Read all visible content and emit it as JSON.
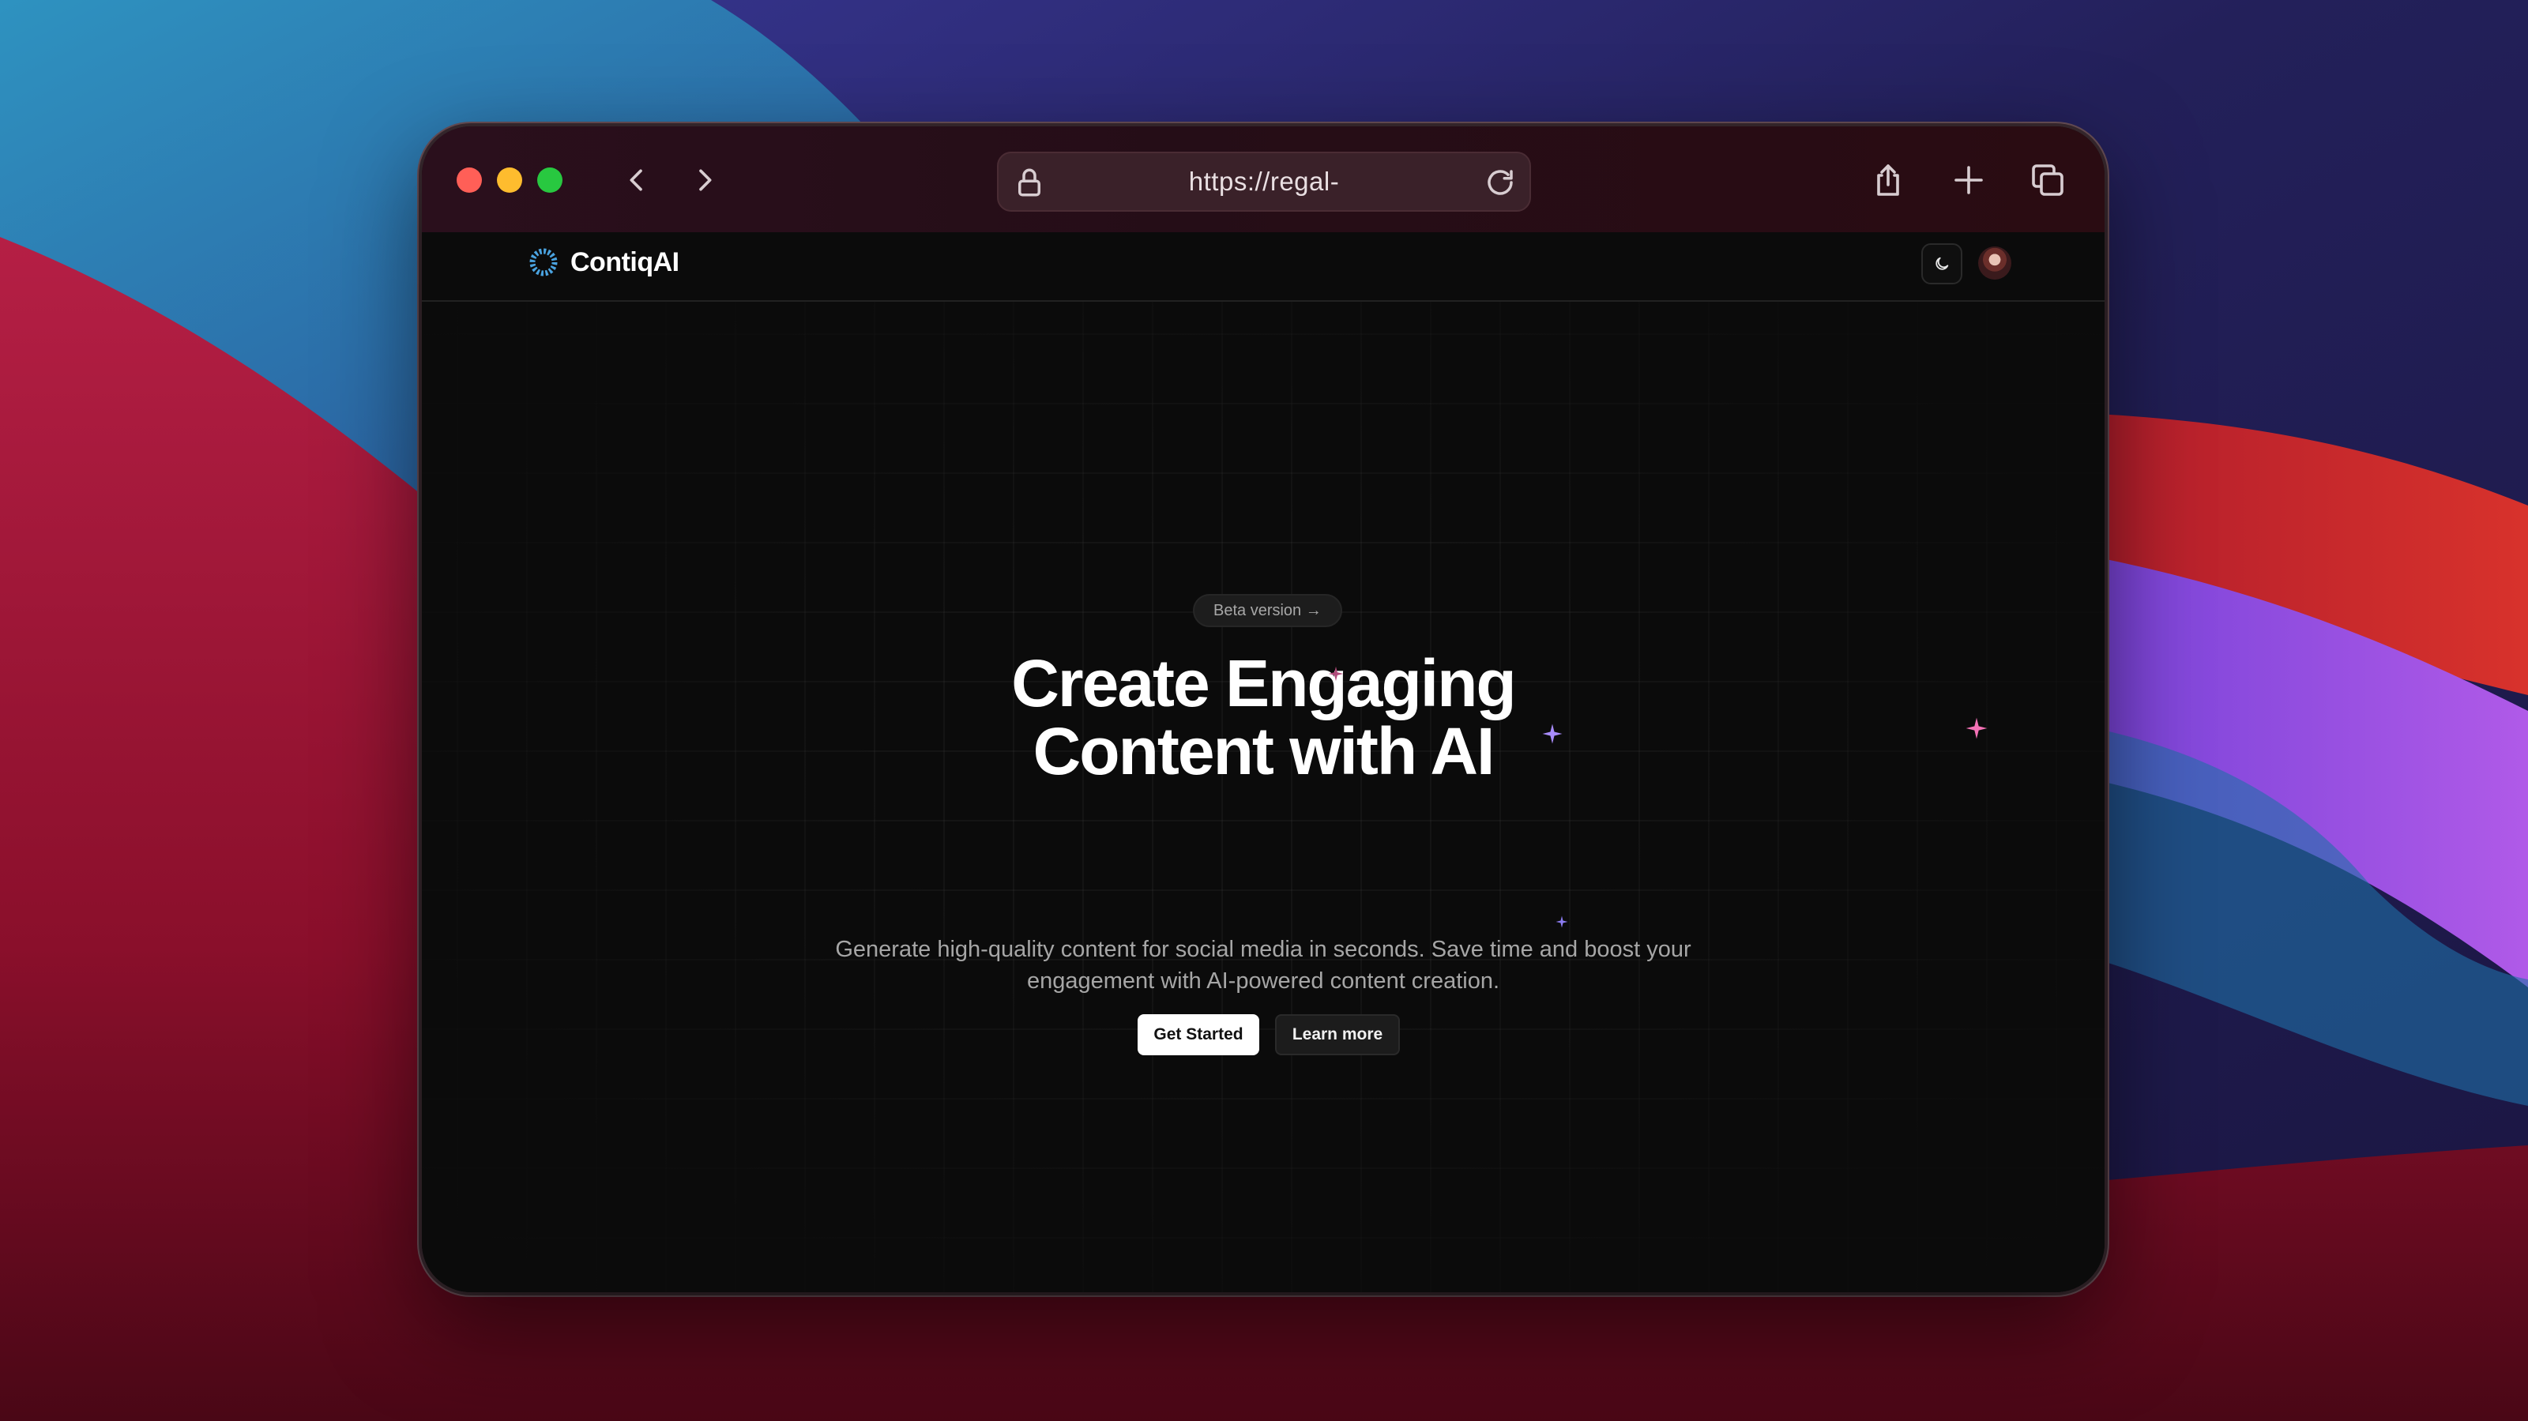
{
  "browser": {
    "url": "https://regal-"
  },
  "site": {
    "brand": "ContiqAI"
  },
  "hero": {
    "badge": "Beta version →",
    "headline_line1": "Create Engaging",
    "headline_line2": "Content with AI",
    "subtext_line1": "Generate high-quality content for social media in seconds. Save time and boost your",
    "subtext_line2": "engagement with AI-powered content creation.",
    "primary_button": "Get Started",
    "secondary_button": "Learn more"
  },
  "icons": {
    "lock": "lock-icon",
    "reload": "reload-icon",
    "back": "chevron-left-icon",
    "forward": "chevron-right-icon",
    "share": "share-icon",
    "new_tab": "plus-icon",
    "tabs": "tabs-icon",
    "theme": "moon-icon"
  },
  "colors": {
    "close": "#ff5f57",
    "minimize": "#febc2e",
    "maximize": "#28c840",
    "sparkle_purple": "#a78bfa",
    "sparkle_pink": "#f472b6"
  }
}
